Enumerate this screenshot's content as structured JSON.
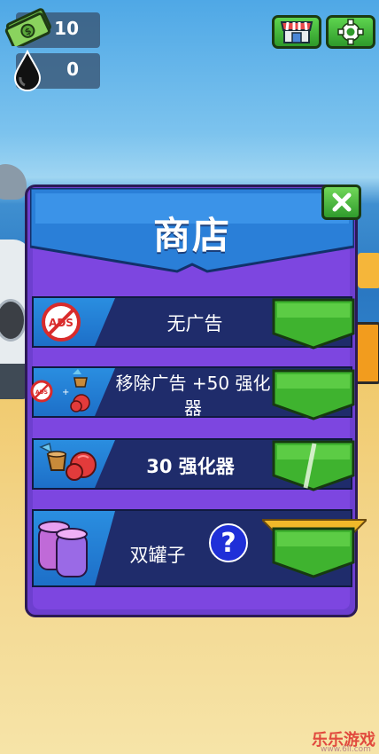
{
  "hud": {
    "money_value": "10",
    "oil_value": "0"
  },
  "shop": {
    "title": "商店",
    "items": [
      {
        "label": "无广告",
        "icon": "no-ads-icon"
      },
      {
        "label_line1": "移除广告 +50 强化",
        "label_line2": "器",
        "icon": "no-ads-plus-boost-icon"
      },
      {
        "label": "30 强化器",
        "icon": "boost-items-icon"
      },
      {
        "label": "双罐子",
        "icon": "double-jars-icon"
      }
    ],
    "info_symbol": "?",
    "ads_text": "ADS"
  },
  "watermark": {
    "text": "乐乐游戏",
    "sub": "www.6ll.com"
  },
  "colors": {
    "panel": "#7d46e0",
    "button_green": "#3fb32f",
    "item_bg": "#1f2c6b",
    "header_blue": "#2a7fd8"
  }
}
